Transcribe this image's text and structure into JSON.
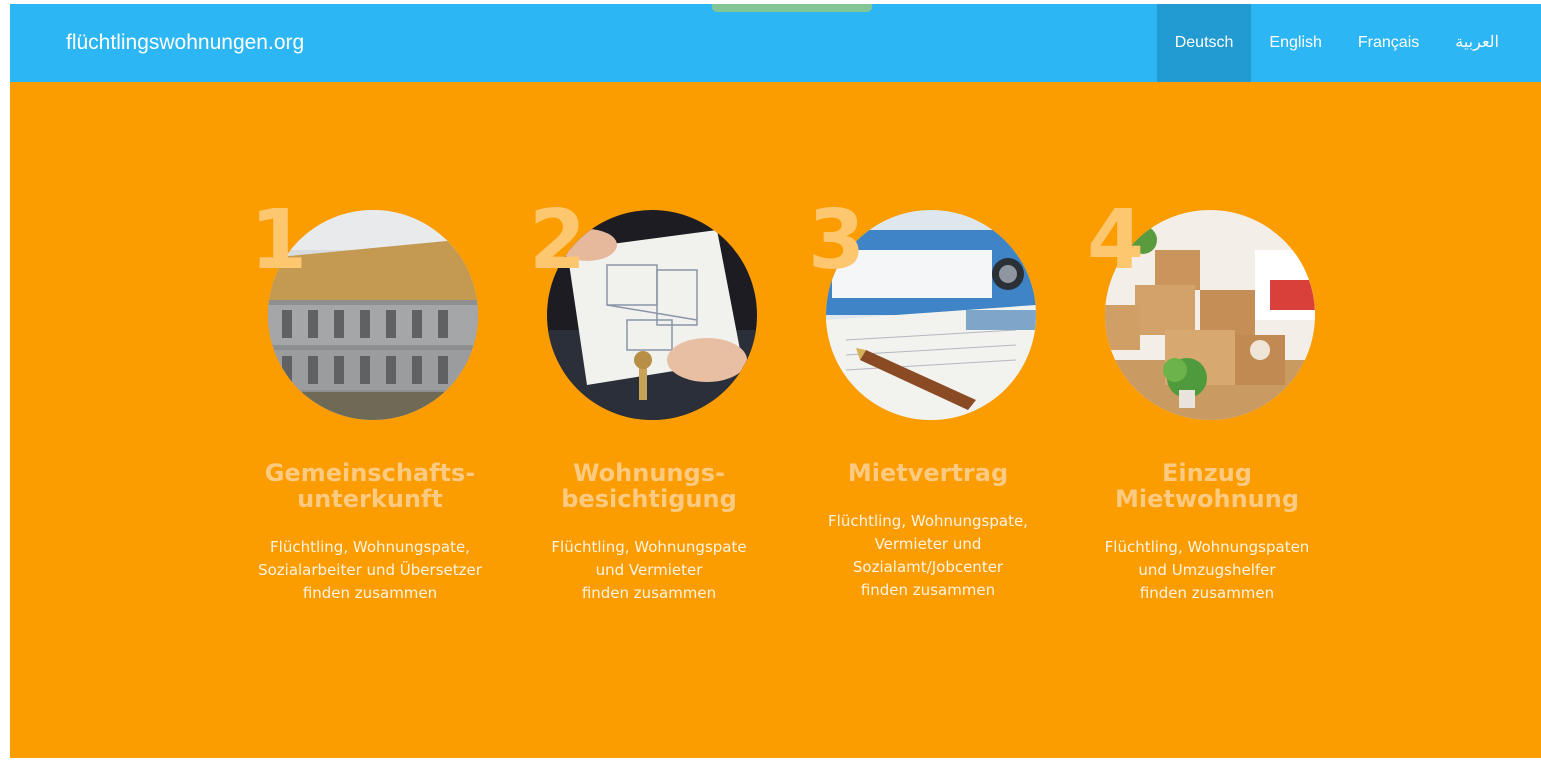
{
  "navbar": {
    "brand": "flüchtlingswohnungen.org",
    "languages": [
      {
        "label": "Deutsch",
        "active": true
      },
      {
        "label": "English",
        "active": false
      },
      {
        "label": "Français",
        "active": false
      },
      {
        "label": "العربية",
        "active": false
      }
    ]
  },
  "steps": [
    {
      "number": "1",
      "title_lines": [
        "Gemeinschafts-",
        "unterkunft"
      ],
      "desc_lines": [
        "Flüchtling, Wohnungspate,",
        "Sozialarbeiter und Übersetzer",
        "finden zusammen"
      ],
      "image": "container-housing-photo"
    },
    {
      "number": "2",
      "title_lines": [
        "Wohnungs-",
        "besichtigung"
      ],
      "desc_lines": [
        "Flüchtling, Wohnungspate",
        "und Vermieter",
        "finden zusammen"
      ],
      "image": "floor-plan-keys-photo"
    },
    {
      "number": "3",
      "title_lines": [
        "Mietvertrag"
      ],
      "desc_lines": [
        "Flüchtling, Wohnungspate,",
        "Vermieter und",
        "Sozialamt/Jobcenter",
        "finden zusammen"
      ],
      "image": "binder-contract-pen-photo"
    },
    {
      "number": "4",
      "title_lines": [
        "Einzug",
        "Mietwohnung"
      ],
      "desc_lines": [
        "Flüchtling, Wohnungspaten",
        "und Umzugshelfer",
        "finden zusammen"
      ],
      "image": "moving-boxes-photo"
    }
  ],
  "colors": {
    "navbar": "#2cb6f4",
    "navbar_active": "#229bd2",
    "hero": "#fb9c00",
    "step_number": "#fdc770",
    "step_title": "#fdca82",
    "step_text": "#fff4e2"
  }
}
